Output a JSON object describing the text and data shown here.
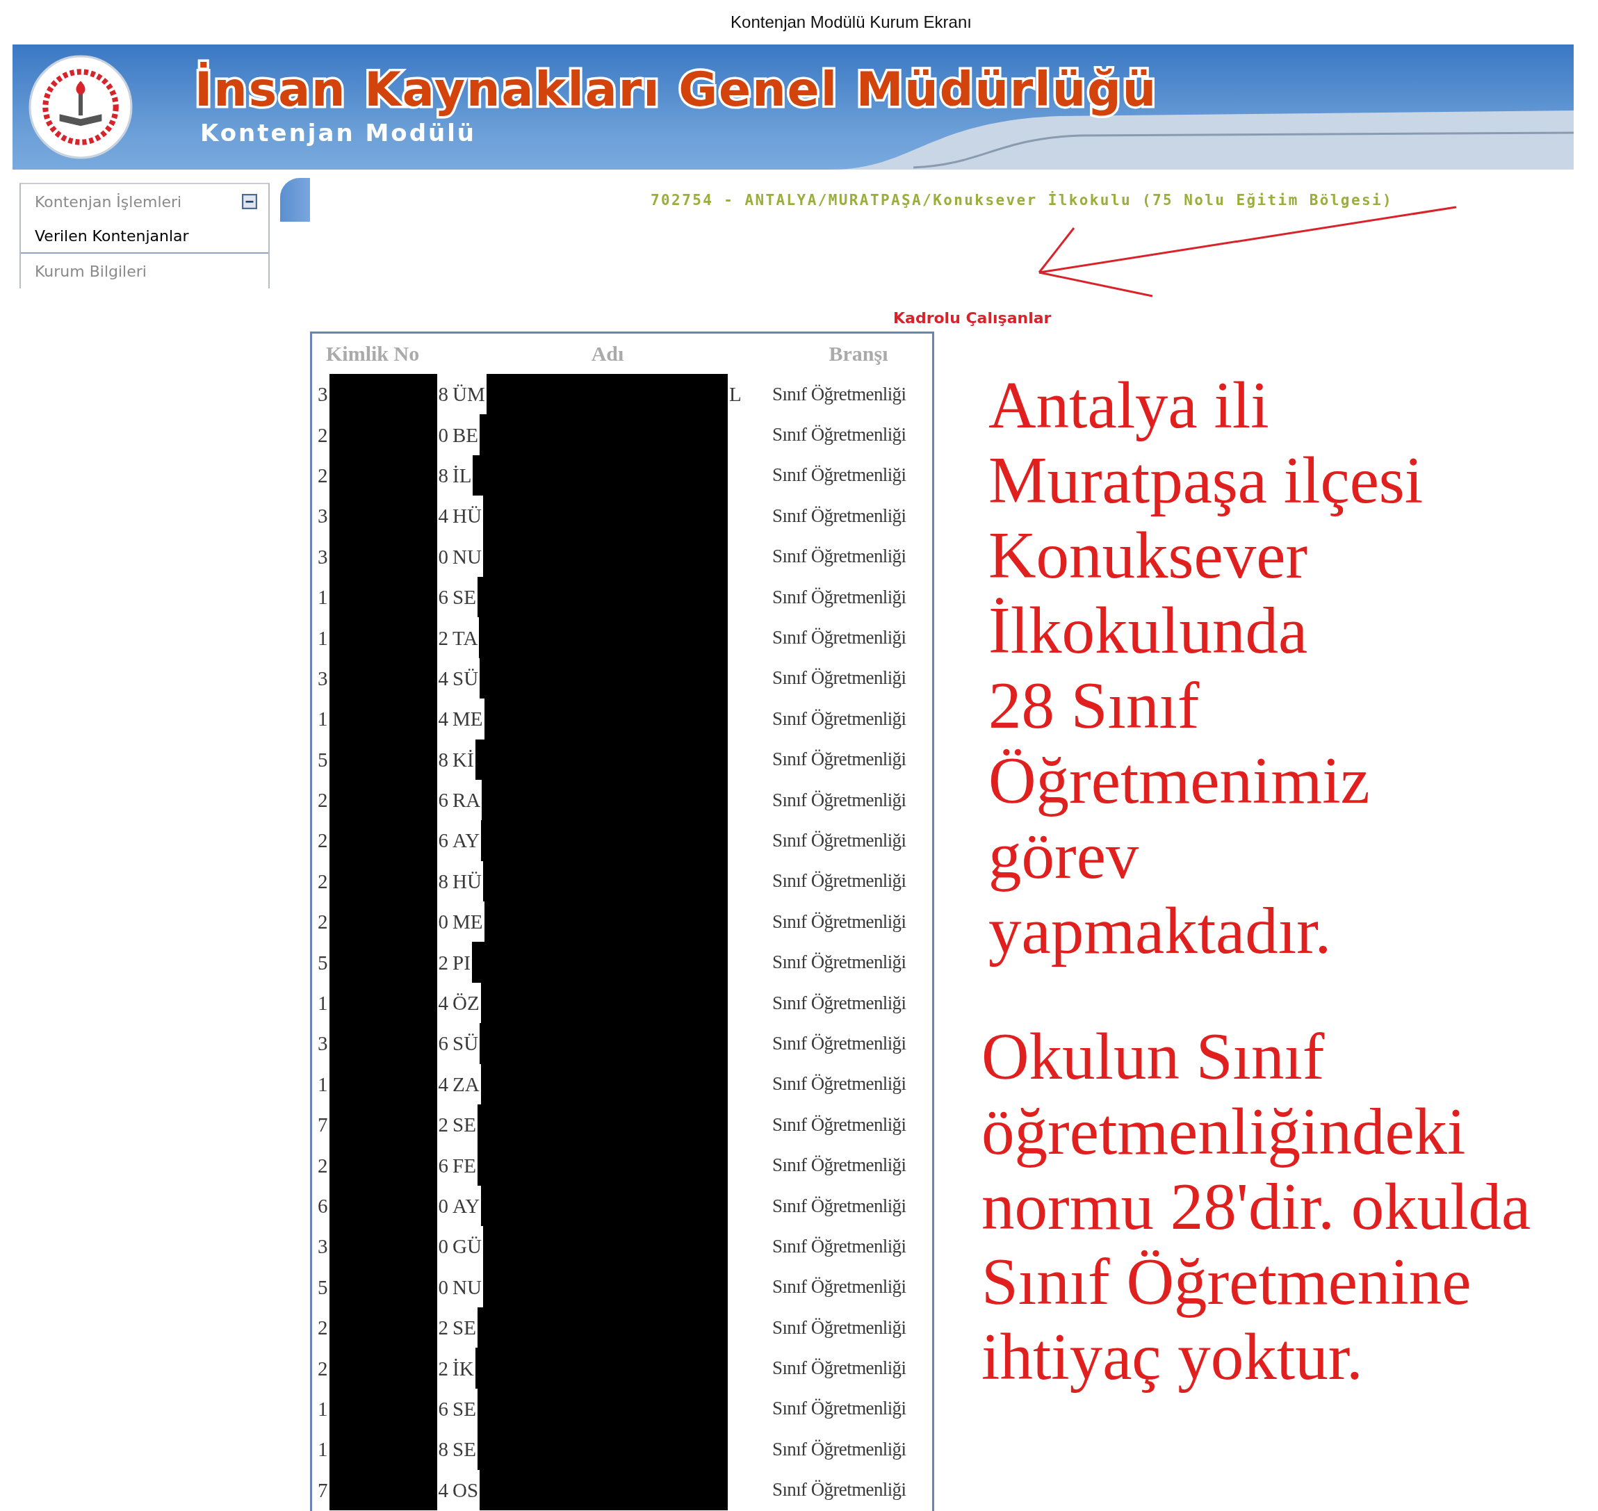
{
  "window": {
    "title": "Kontenjan Modülü Kurum Ekranı"
  },
  "header": {
    "title": "İnsan Kaynakları Genel Müdürlüğü",
    "subtitle": "Kontenjan Modülü"
  },
  "sidebar": {
    "items": [
      {
        "label": "Kontenjan İşlemleri",
        "expanded": true,
        "children": [
          {
            "label": "Verilen Kontenjanlar",
            "selected": true
          }
        ]
      },
      {
        "label": "Kurum Bilgileri"
      }
    ]
  },
  "institution": "702754 - ANTALYA/MURATPAŞA/Konuksever İlkokulu (75 Nolu Eğitim Bölgesi)",
  "table": {
    "title": "Kadrolu Çalışanlar",
    "columns": [
      "Kimlik No",
      "Adı",
      "Branşı"
    ],
    "rows": [
      {
        "id_start": "3",
        "id_end": "8",
        "name_start": "ÜM",
        "name_end": "L",
        "branch": "Sınıf Öğretmenliği"
      },
      {
        "id_start": "2",
        "id_end": "0",
        "name_start": "BE",
        "branch": "Sınıf Öğretmenliği"
      },
      {
        "id_start": "2",
        "id_end": "8",
        "name_start": "İL",
        "branch": "Sınıf Öğretmenliği"
      },
      {
        "id_start": "3",
        "id_end": "4",
        "name_start": "HÜ",
        "branch": "Sınıf Öğretmenliği"
      },
      {
        "id_start": "3",
        "id_end": "0",
        "name_start": "NU",
        "branch": "Sınıf Öğretmenliği"
      },
      {
        "id_start": "1",
        "id_end": "6",
        "name_start": "SE",
        "branch": "Sınıf Öğretmenliği"
      },
      {
        "id_start": "1",
        "id_end": "2",
        "name_start": "TA",
        "branch": "Sınıf Öğretmenliği"
      },
      {
        "id_start": "3",
        "id_end": "4",
        "name_start": "SÜ",
        "branch": "Sınıf Öğretmenliği"
      },
      {
        "id_start": "1",
        "id_end": "4",
        "name_start": "ME",
        "branch": "Sınıf Öğretmenliği"
      },
      {
        "id_start": "5",
        "id_end": "8",
        "name_start": "Kİ",
        "branch": "Sınıf Öğretmenliği"
      },
      {
        "id_start": "2",
        "id_end": "6",
        "name_start": "RA",
        "branch": "Sınıf Öğretmenliği"
      },
      {
        "id_start": "2",
        "id_end": "6",
        "name_start": "AY",
        "branch": "Sınıf Öğretmenliği"
      },
      {
        "id_start": "2",
        "id_end": "8",
        "name_start": "HÜ",
        "branch": "Sınıf Öğretmenliği"
      },
      {
        "id_start": "2",
        "id_end": "0",
        "name_start": "ME",
        "branch": "Sınıf Öğretmenliği"
      },
      {
        "id_start": "5",
        "id_end": "2",
        "name_start": "PI",
        "branch": "Sınıf Öğretmenliği"
      },
      {
        "id_start": "1",
        "id_end": "4",
        "name_start": "ÖZ",
        "branch": "Sınıf Öğretmenliği"
      },
      {
        "id_start": "3",
        "id_end": "6",
        "name_start": "SÜ",
        "branch": "Sınıf Öğretmenliği"
      },
      {
        "id_start": "1",
        "id_end": "4",
        "name_start": "ZA",
        "branch": "Sınıf Öğretmenliği"
      },
      {
        "id_start": "7",
        "id_end": "2",
        "name_start": "SE",
        "branch": "Sınıf Öğretmenliği"
      },
      {
        "id_start": "2",
        "id_end": "6",
        "name_start": "FE",
        "branch": "Sınıf Öğretmenliği"
      },
      {
        "id_start": "6",
        "id_end": "0",
        "name_start": "AY",
        "branch": "Sınıf Öğretmenliği"
      },
      {
        "id_start": "3",
        "id_end": "0",
        "name_start": "GÜ",
        "branch": "Sınıf Öğretmenliği"
      },
      {
        "id_start": "5",
        "id_end": "0",
        "name_start": "NU",
        "branch": "Sınıf Öğretmenliği"
      },
      {
        "id_start": "2",
        "id_end": "2",
        "name_start": "SE",
        "branch": "Sınıf Öğretmenliği"
      },
      {
        "id_start": "2",
        "id_end": "2",
        "name_start": "İK",
        "branch": "Sınıf Öğretmenliği"
      },
      {
        "id_start": "1",
        "id_end": "6",
        "name_start": "SE",
        "branch": "Sınıf Öğretmenliği"
      },
      {
        "id_start": "1",
        "id_end": "8",
        "name_start": "SE",
        "branch": "Sınıf Öğretmenliği"
      },
      {
        "id_start": "7",
        "id_end": "4",
        "name_start": "OS",
        "branch": "Sınıf Öğretmenliği"
      }
    ]
  },
  "annotations": [
    {
      "text": "Antalya ili\nMuratpaşa ilçesi\nKonuksever\nİlkokulunda\n28 Sınıf\nÖğretmenimiz\ngörev\nyapmaktadır."
    },
    {
      "text": "Okulun Sınıf\nöğretmenliğindeki\nnormu 28'dir. okulda\nSınıf Öğretmenine\nihtiyaç yoktur."
    }
  ]
}
